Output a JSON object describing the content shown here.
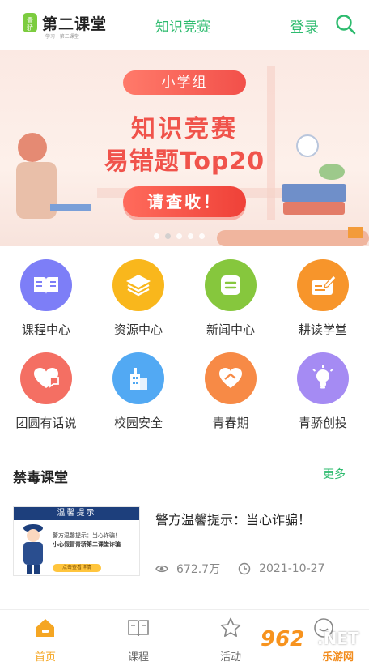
{
  "header": {
    "logo_text": "第二课堂",
    "logo_sub": "学习 · 第二课堂",
    "title": "知识竞赛",
    "login": "登录"
  },
  "banner": {
    "pill": "小学组",
    "title1": "知识竞赛",
    "title2": "易错题Top20",
    "button": "请查收！",
    "slide_count": 5,
    "active_slide": 1
  },
  "grid": [
    {
      "label": "课程中心",
      "color": "#7d7ef7",
      "icon": "book-icon"
    },
    {
      "label": "资源中心",
      "color": "#f9b71c",
      "icon": "layers-icon"
    },
    {
      "label": "新闻中心",
      "color": "#86c73d",
      "icon": "news-icon"
    },
    {
      "label": "耕读学堂",
      "color": "#f7952b",
      "icon": "pen-card-icon"
    },
    {
      "label": "团圆有话说",
      "color": "#f46f63",
      "icon": "heart-chat-icon"
    },
    {
      "label": "校园安全",
      "color": "#52a9f3",
      "icon": "building-icon"
    },
    {
      "label": "青春期",
      "color": "#f78a46",
      "icon": "hands-heart-icon"
    },
    {
      "label": "青骄创投",
      "color": "#a58bf3",
      "icon": "bulb-icon"
    }
  ],
  "section": {
    "title": "禁毒课堂",
    "more": "更多"
  },
  "news": {
    "thumb_head": "温馨提示",
    "thumb_line1": "警方温馨提示：当心诈骗！",
    "thumb_line2": "小心假冒青骄第二课堂诈骗",
    "thumb_tag": "点击查看详情",
    "title": "警方温馨提示：当心诈骗！",
    "views": "672.7万",
    "date": "2021-10-27"
  },
  "tabbar": [
    {
      "label": "首页",
      "active": true
    },
    {
      "label": "课程",
      "active": false
    },
    {
      "label": "活动",
      "active": false
    },
    {
      "label": "",
      "active": false
    }
  ],
  "watermark": {
    "big": "962",
    "net": ".NET",
    "small": "乐游网"
  }
}
